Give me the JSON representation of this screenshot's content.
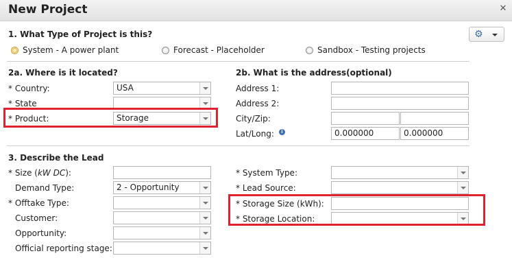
{
  "window": {
    "title": "New Project",
    "close_glyph": "✕"
  },
  "colors": {
    "highlight_box": "#e0212f",
    "info_icon": "#3d6fb5",
    "selected_radio": "#e5c86a"
  },
  "section1": {
    "heading": "1. What Type of Project is this?",
    "options": [
      {
        "label": "System - A power plant",
        "selected": true
      },
      {
        "label": "Forecast - Placeholder",
        "selected": false
      },
      {
        "label": "Sandbox - Testing projects",
        "selected": false
      }
    ],
    "settings_icon": "gear-icon"
  },
  "section2a": {
    "heading": "2a. Where is it located?",
    "country_label": "* Country:",
    "country_value": "USA",
    "state_label": "* State",
    "state_value": "",
    "product_label": "* Product:",
    "product_value": "Storage"
  },
  "section2b": {
    "heading": "2b. What is the address(optional)",
    "address1_label": "Address 1:",
    "address2_label": "Address 2:",
    "cityzip_label": "City/Zip:",
    "latlong_label": "Lat/Long:",
    "lat_value": "0.000000",
    "long_value": "0.000000"
  },
  "section3": {
    "heading": "3. Describe the Lead",
    "size_label_prefix": "* Size (",
    "size_label_unit": "kW DC",
    "size_label_suffix": "):",
    "demand_type_label": "Demand Type:",
    "demand_type_value": "2 - Opportunity",
    "offtake_type_label": "* Offtake Type:",
    "customer_label": "Customer:",
    "opportunity_label": "Opportunity:",
    "reporting_stage_label": "Official reporting stage:",
    "system_type_label": "* System Type:",
    "lead_source_label": "* Lead Source:",
    "storage_size_label": "* Storage Size (kWh):",
    "storage_location_label": "* Storage Location:"
  }
}
